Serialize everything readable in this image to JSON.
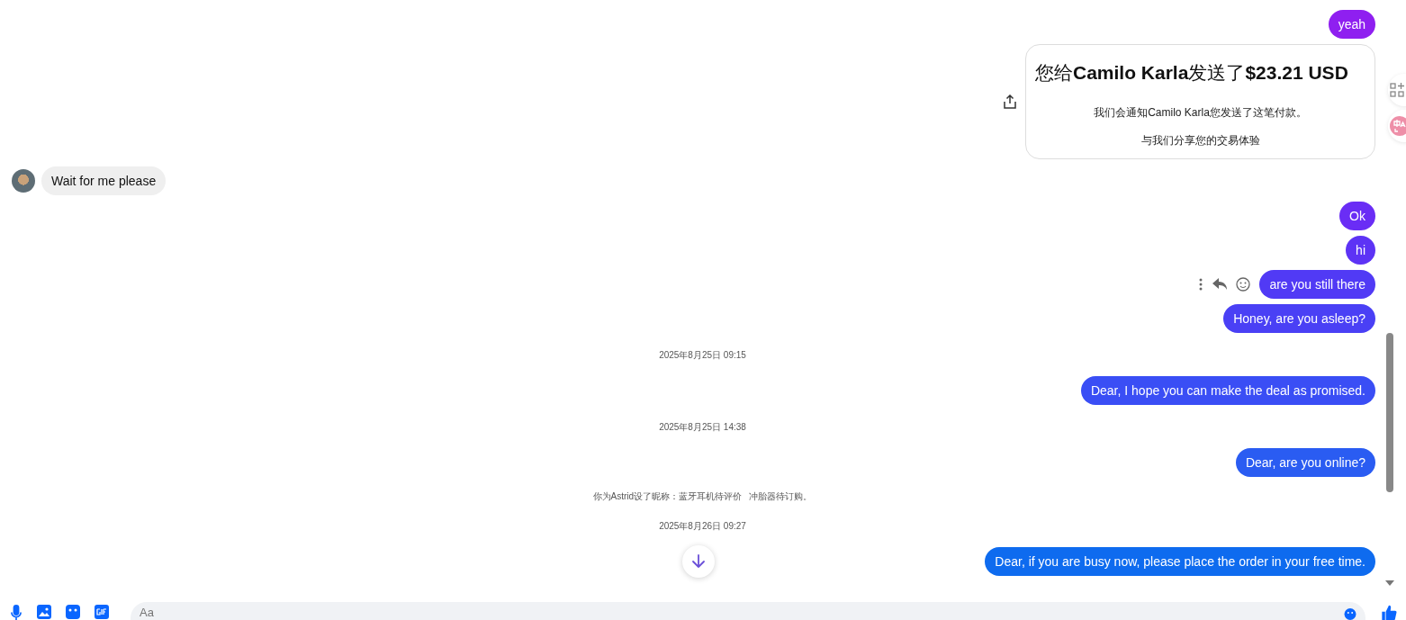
{
  "messages": [
    {
      "kind": "outgoing",
      "text": "yeah",
      "color": "#8f1ff0"
    },
    {
      "kind": "payment",
      "title": "您给**Camilo Karla**发送了**$23.21 USD**",
      "lines": [
        "我们会通知Camilo Karla您发送了这笔付款。",
        "与我们分享您的交易体验"
      ]
    },
    {
      "kind": "incoming",
      "text": "Wait for me please"
    },
    {
      "kind": "outgoing",
      "text": "Ok",
      "color": "#6a2df5"
    },
    {
      "kind": "outgoing",
      "text": "hi",
      "color": "#5d33f5"
    },
    {
      "kind": "outgoing",
      "text": "are you still there",
      "color": "#513af5",
      "hovered": true
    },
    {
      "kind": "outgoing",
      "text": "Honey, are you asleep?",
      "color": "#4a40f5"
    },
    {
      "kind": "timestamp",
      "text": "2025年8月25日 09:15"
    },
    {
      "kind": "outgoing",
      "text": "Dear, I hope you can make the deal as promised.",
      "color": "#3a4ef5"
    },
    {
      "kind": "timestamp",
      "text": "2025年8月25日 14:38"
    },
    {
      "kind": "outgoing",
      "text": "Dear, are you online?",
      "color": "#2a5cf2"
    },
    {
      "kind": "notice",
      "text": "你为Astrid设了昵称：蓝牙耳机待评价   冲胎器待订购。"
    },
    {
      "kind": "timestamp",
      "text": "2025年8月26日 09:27"
    },
    {
      "kind": "outgoing",
      "text": "Dear, if you are busy now, please place the order in your free time.",
      "color": "#0e6bef"
    }
  ],
  "composer": {
    "placeholder": "Aa"
  }
}
